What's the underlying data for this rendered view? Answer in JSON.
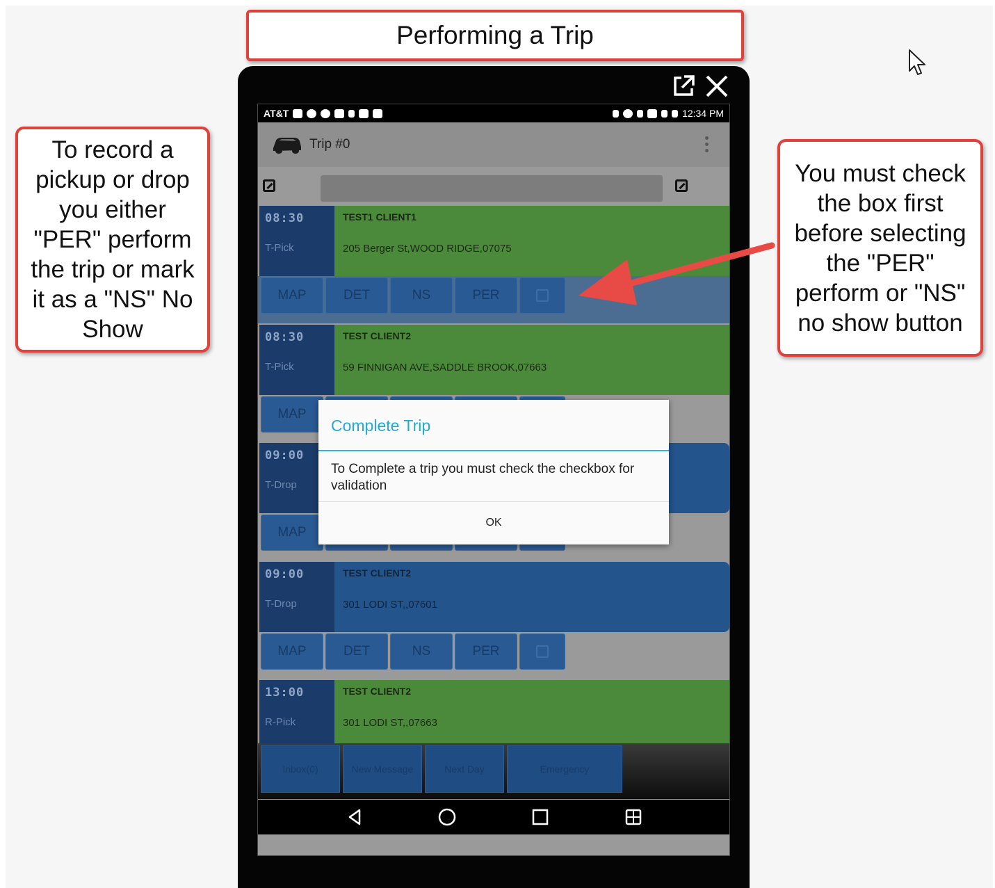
{
  "annotations": {
    "title": "Performing a Trip",
    "left_note": "To record a pickup or drop you either \"PER\" perform the trip or mark it as a \"NS\" No Show",
    "right_note": "You must check the box first before selecting the \"PER\" perform or \"NS\" no show button",
    "arrow_color": "#e84b45",
    "border_color": "#e0413a"
  },
  "status_bar": {
    "carrier": "AT&T",
    "time": "12:34 PM"
  },
  "app_bar": {
    "title": "Trip #0",
    "icon": "car-icon"
  },
  "trips": [
    {
      "time": "08:30",
      "type": "T-Pick",
      "name": "TEST1 CLIENT1",
      "address": "205 Berger St,WOOD RIDGE,07075",
      "color": "green"
    },
    {
      "time": "08:30",
      "type": "T-Pick",
      "name": "TEST CLIENT2",
      "address": "59 FINNIGAN AVE,SADDLE BROOK,07663",
      "color": "green"
    },
    {
      "time": "09:00",
      "type": "T-Drop",
      "name": "",
      "address": "",
      "color": "blue"
    },
    {
      "time": "09:00",
      "type": "T-Drop",
      "name": "TEST CLIENT2",
      "address": "301 LODI ST,,07601",
      "color": "blue"
    },
    {
      "time": "13:00",
      "type": "R-Pick",
      "name": "TEST CLIENT2",
      "address": "301 LODI ST,,07663",
      "color": "green"
    }
  ],
  "trip_buttons": {
    "map": "MAP",
    "details": "DET",
    "no_show": "NS",
    "perform": "PER"
  },
  "bottom_tabs": [
    {
      "label": "Inbox(0)"
    },
    {
      "label": "New Message"
    },
    {
      "label": "Next Day"
    },
    {
      "label": "Emergency"
    }
  ],
  "dialog": {
    "title": "Complete Trip",
    "message": "To Complete a trip you must check the checkbox for validation",
    "ok": "OK"
  },
  "colors": {
    "trip_green": "#4a8a3a",
    "trip_blue": "#23548c",
    "time_column": "#1b3c6a",
    "dialog_accent": "#26a9d3"
  }
}
